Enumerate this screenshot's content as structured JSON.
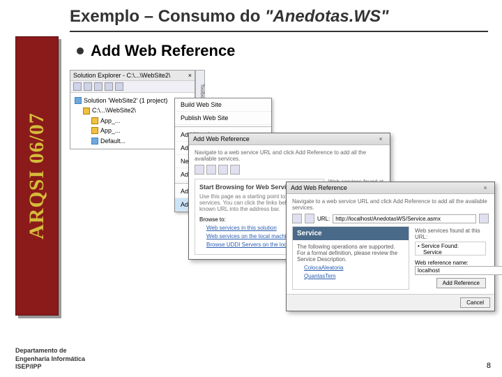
{
  "title_prefix": "Exemplo – Consumo do ",
  "title_em": "\"Anedotas.WS\"",
  "sidebar_label": "ARQSI 06/07",
  "bullet_text": "Add Web Reference",
  "footer": {
    "line1": "Departamento de",
    "line2": "Engenharia Informática",
    "line3": "ISEP/IPP"
  },
  "page_number": "8",
  "solution_explorer": {
    "title": "Solution Explorer - C:\\...\\WebSite2\\",
    "solution": "Solution 'WebSite2' (1 project)",
    "project": "C:\\...\\WebSite2\\",
    "items": [
      "App_...",
      "App_...",
      "Default..."
    ]
  },
  "vtab": "Toolbox",
  "context_menu": {
    "items": [
      "Build Web Site",
      "Publish Web Site",
      "Add New Item...",
      "Add Existing Item...",
      "New Folder",
      "Add ASP.NET Folder",
      "Add Reference...",
      "Add Web Reference..."
    ]
  },
  "dialog1": {
    "title": "Add Web Reference",
    "desc": "Navigate to a web service URL and click Add Reference to add all the available services.",
    "heading": "Start Browsing for Web Services",
    "sub": "Use this page as a starting point to find Web services. You can click the links below, or type a known URL into the address bar.",
    "browse": "Browse to:",
    "links": [
      "Web services in this solution",
      "Web services on the local machine",
      "Browse UDDI Servers on the local network"
    ],
    "side_note": "Web services found at this URL:"
  },
  "dialog2": {
    "title": "Add Web Reference",
    "desc": "Navigate to a web service URL and click Add Reference to add all the available services.",
    "url_label": "URL:",
    "url_value": "http://localhost/AnedotasWS/Service.asmx",
    "service_header": "Service",
    "service_desc": "The following operations are supported. For a formal definition, please review the Service Description.",
    "ops": [
      "ColocaAleatoria",
      "QuantasTem"
    ],
    "found_label": "Web services found at this URL:",
    "found_item": "• Service Found:",
    "found_service": "Service",
    "ref_label": "Web reference name:",
    "ref_value": "localhost",
    "add_btn": "Add Reference",
    "cancel_btn": "Cancel"
  }
}
